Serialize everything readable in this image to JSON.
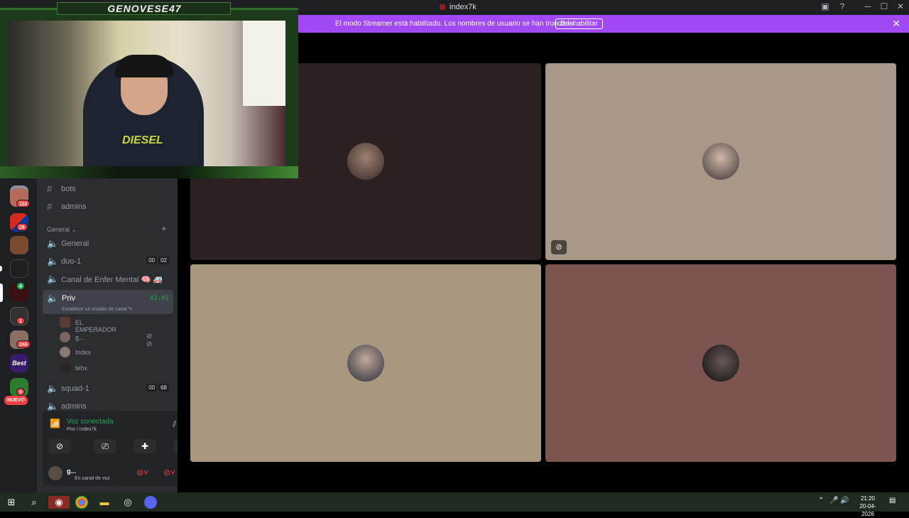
{
  "titlebar": {
    "back": "←",
    "forward": "→",
    "title": "index7k",
    "minimize": "─",
    "maximize": "☐",
    "close": "✕"
  },
  "banner": {
    "message": "El modo Streamer está habilitado. Los nombres de usuario se han truncado.",
    "button_label": "Deshabilitar",
    "close": "✕",
    "color": "#a049f5"
  },
  "server_rail": {
    "badges": [
      "118",
      "26",
      "4",
      "1",
      "249",
      "9"
    ],
    "new_label": "NUEVO"
  },
  "sidebar": {
    "text_channels": [
      {
        "name": "bots",
        "icon": "hash-icon"
      },
      {
        "name": "admins",
        "icon": "hash-icon"
      }
    ],
    "category": {
      "name": "General",
      "chevron": "⌄",
      "add": "+"
    },
    "voice_channels": [
      {
        "name": "General"
      },
      {
        "name": "duo-1",
        "left": "00",
        "right": "02"
      },
      {
        "name": "Canal de Enfer Mental 🧠 🚑"
      }
    ],
    "active_channel": {
      "name": "Priv",
      "timer": "42:01",
      "status": "Establece un estado de canal ✎"
    },
    "members": [
      {
        "name": "EL EMPERADOR"
      },
      {
        "name": "g..."
      },
      {
        "name": "Index"
      },
      {
        "name": "tehx"
      }
    ],
    "after_channels": [
      {
        "name": "squad-1",
        "left": "00",
        "right": "68"
      },
      {
        "name": "admins"
      }
    ]
  },
  "voice_panel": {
    "title": "Voz conectada",
    "subtitle": "Priv / index7k",
    "accent": "#23a55a"
  },
  "user_panel": {
    "name": "g...",
    "status": "En canal de voz"
  },
  "webcam": {
    "name": "GENOVESE47",
    "shirt_text": "DIESEL"
  },
  "taskbar": {
    "time": "21:20",
    "date": "20-04-2026"
  }
}
